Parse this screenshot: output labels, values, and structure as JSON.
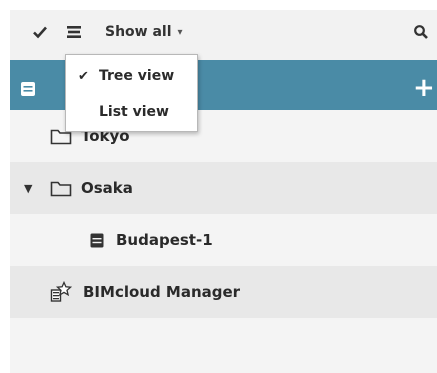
{
  "toolbar": {
    "filter_label": "Show all",
    "caret": "▾",
    "icons": [
      "checkmark-icon",
      "list-icon",
      "search-icon"
    ]
  },
  "view_menu": {
    "items": [
      {
        "label": "Tree view",
        "checked": true,
        "check_glyph": "✔"
      },
      {
        "label": "List view",
        "checked": false,
        "check_glyph": ""
      }
    ]
  },
  "header": {
    "add_glyph": "+",
    "colors": {
      "background": "#4a8ba6",
      "foreground": "#ffffff"
    }
  },
  "tree": {
    "rows": [
      {
        "label": "Tokyo",
        "icon": "folder-icon",
        "expander": ""
      },
      {
        "label": "Osaka",
        "icon": "folder-icon",
        "expander": "▼"
      },
      {
        "label": "Budapest-1",
        "icon": "server-icon",
        "expander": ""
      },
      {
        "label": "BIMcloud Manager",
        "icon": "manager-icon",
        "expander": ""
      }
    ]
  }
}
